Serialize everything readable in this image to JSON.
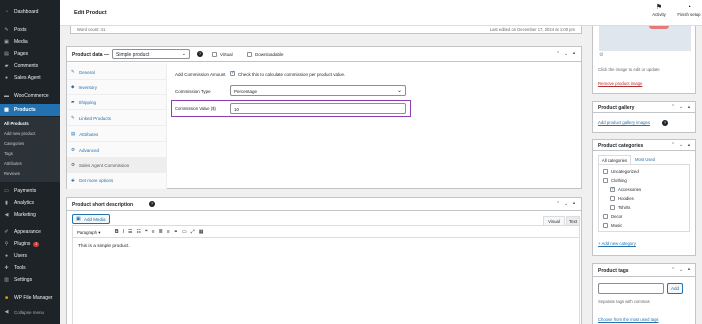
{
  "sidebar": {
    "items": [
      {
        "label": "Dashboard",
        "icon": "dashboard-icon"
      },
      {
        "label": "Posts",
        "icon": "pin-icon"
      },
      {
        "label": "Media",
        "icon": "media-icon"
      },
      {
        "label": "Pages",
        "icon": "page-icon"
      },
      {
        "label": "Comments",
        "icon": "comment-icon"
      },
      {
        "label": "Sales Agent",
        "icon": "user-icon"
      },
      {
        "label": "WooCommerce",
        "icon": "woo-icon"
      },
      {
        "label": "Products",
        "icon": "archive-icon"
      }
    ],
    "submenu": [
      "All Products",
      "Add new product",
      "Categories",
      "Tags",
      "Attributes",
      "Reviews"
    ],
    "bottom_items": [
      {
        "label": "Payments",
        "icon": "payments-icon"
      },
      {
        "label": "Analytics",
        "icon": "chart-icon"
      },
      {
        "label": "Marketing",
        "icon": "megaphone-icon"
      },
      {
        "label": "Appearance",
        "icon": "brush-icon"
      },
      {
        "label": "Plugins",
        "icon": "plugin-icon",
        "badge": "2"
      },
      {
        "label": "Users",
        "icon": "users-icon"
      },
      {
        "label": "Tools",
        "icon": "wrench-icon"
      },
      {
        "label": "Settings",
        "icon": "settings-icon"
      },
      {
        "label": "WP File Manager",
        "icon": "folder-icon"
      },
      {
        "label": "Collapse menu",
        "icon": "collapse-icon"
      }
    ]
  },
  "header": {
    "title": "Edit Product",
    "activity": "Activity",
    "finish_setup": "Finish setup"
  },
  "editor_footer": {
    "word_count": "Word count: 41",
    "last_edited": "Last edited on December 17, 2024 at 1:00 pm"
  },
  "product_data": {
    "title": "Product data —",
    "type_selected": "Simple product",
    "virtual_label": "Virtual",
    "downloadable_label": "Downloadable",
    "tabs": [
      {
        "label": "General",
        "icon": "wrench-icon"
      },
      {
        "label": "Inventory",
        "icon": "tag-icon"
      },
      {
        "label": "Shipping",
        "icon": "truck-icon"
      },
      {
        "label": "Linked Products",
        "icon": "link-icon"
      },
      {
        "label": "Attributes",
        "icon": "list-icon"
      },
      {
        "label": "Advanced",
        "icon": "gear-icon"
      },
      {
        "label": "Sales Agent Commission",
        "icon": "gear-icon"
      },
      {
        "label": "Get more options",
        "icon": "plugin-icon"
      }
    ],
    "add_commission_label": "Add Commission Amount",
    "add_commission_desc": "Check this to calculate commission per product value.",
    "commission_type_label": "Commission Type",
    "commission_type_value": "Percentage",
    "commission_value_label": "Commission Value ($)",
    "commission_value": "10"
  },
  "short_desc": {
    "title": "Product short description",
    "add_media": "Add Media",
    "tab_visual": "Visual",
    "tab_text": "Text",
    "format_value": "Paragraph",
    "content": "This is a simple product."
  },
  "right": {
    "image_hint": "Click the image to edit or update",
    "remove_image": "Remove product image",
    "gallery_title": "Product gallery",
    "gallery_link": "Add product gallery images",
    "categories_title": "Product categories",
    "cat_tab_all": "All categories",
    "cat_tab_most": "Most Used",
    "categories": [
      {
        "label": "Uncategorized",
        "checked": false,
        "indent": 0
      },
      {
        "label": "Clothing",
        "checked": false,
        "indent": 0
      },
      {
        "label": "Accessories",
        "checked": true,
        "indent": 1
      },
      {
        "label": "Hoodies",
        "checked": false,
        "indent": 1
      },
      {
        "label": "Tshirts",
        "checked": false,
        "indent": 1
      },
      {
        "label": "Decor",
        "checked": false,
        "indent": 0
      },
      {
        "label": "Music",
        "checked": false,
        "indent": 0
      }
    ],
    "add_category": "+ Add new category",
    "tags_title": "Product tags",
    "tags_add": "Add",
    "tags_hint": "Separate tags with commas",
    "tags_choose": "Choose from the most used tags"
  },
  "colors": {
    "accent": "#2271b1",
    "sidebar": "#1d2327",
    "highlight_border": "#8c3cb4",
    "danger": "#b32d2e"
  }
}
